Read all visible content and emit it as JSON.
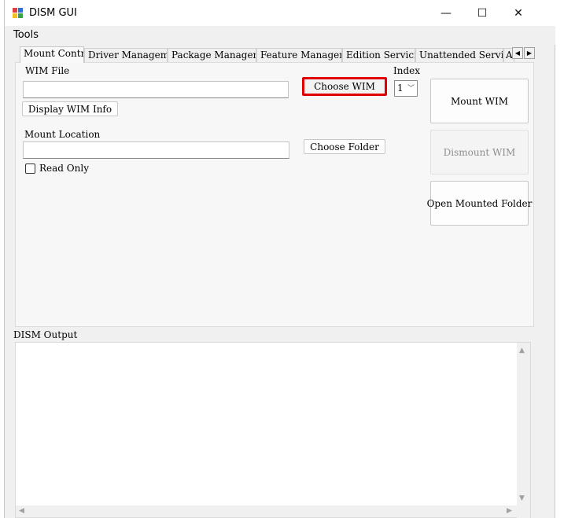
{
  "window": {
    "title": "DISM GUI",
    "controls": {
      "minimize": "—",
      "maximize": "☐",
      "close": "✕"
    }
  },
  "menu": {
    "tools": "Tools"
  },
  "tabs": [
    {
      "label": "Mount Control",
      "active": true
    },
    {
      "label": "Driver Management"
    },
    {
      "label": "Package Management"
    },
    {
      "label": "Feature Management"
    },
    {
      "label": "Edition Servicing"
    },
    {
      "label": "Unattended Servicing"
    },
    {
      "label": "A"
    }
  ],
  "tab_scroll": {
    "left": "◀",
    "right": "▶"
  },
  "mount_control": {
    "wim_file_label": "WIM File",
    "wim_file_value": "",
    "choose_wim": "Choose WIM",
    "index_label": "Index",
    "index_value": "1",
    "index_chevron": "﹀",
    "display_wim_info": "Display WIM Info",
    "mount_location_label": "Mount Location",
    "mount_location_value": "",
    "choose_folder": "Choose Folder",
    "read_only": "Read Only",
    "mount_wim": "Mount WIM",
    "dismount_wim": "Dismount WIM",
    "open_mounted_folder": "Open Mounted Folder"
  },
  "output": {
    "label": "DISM Output",
    "text": "",
    "scroll_up": "▲",
    "scroll_down": "▼",
    "scroll_left": "◀",
    "scroll_right": "▶"
  },
  "colors": {
    "highlight_border": "#e00000",
    "icon_red": "#e04040",
    "icon_blue": "#2f6fd6",
    "icon_yellow": "#f0c020",
    "icon_green": "#3aa04a"
  }
}
